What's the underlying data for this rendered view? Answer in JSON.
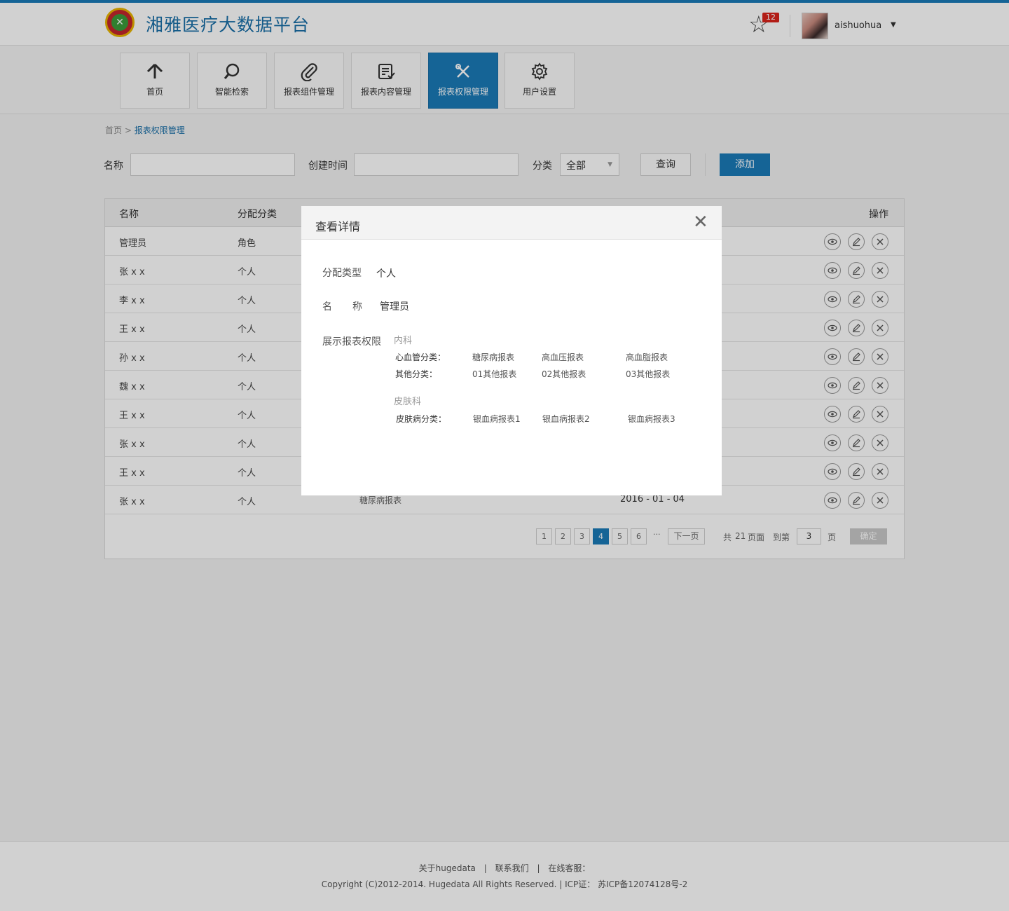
{
  "header": {
    "app_title": "湘雅医疗大数据平台",
    "logo_glyph": "✕",
    "notifications_count": "12",
    "username": "aishuohua",
    "user_caret": "▼",
    "accent_color": "#1a7ab8"
  },
  "nav": [
    {
      "label": "首页",
      "icon": "home-icon",
      "glyph": "⌂"
    },
    {
      "label": "智能检索",
      "icon": "search-icon",
      "glyph": "⚲"
    },
    {
      "label": "报表组件管理",
      "icon": "paperclip-icon",
      "glyph": "📎"
    },
    {
      "label": "报表内容管理",
      "icon": "report-icon",
      "glyph": "▤"
    },
    {
      "label": "报表权限管理",
      "icon": "tools-icon",
      "glyph": "✂",
      "active": true
    },
    {
      "label": "用户设置",
      "icon": "gear-icon",
      "glyph": "⚙"
    }
  ],
  "breadcrumb": {
    "home": "首页",
    "sep": ">",
    "current": "报表权限管理"
  },
  "filters": {
    "name_label": "名称",
    "created_label": "创建时间",
    "category_label": "分类",
    "category_value": "全部",
    "query_button": "查询",
    "add_button": "添加"
  },
  "table": {
    "headers": {
      "name": "名称",
      "category": "分配分类",
      "actions": "操作"
    },
    "rows": [
      {
        "name": "管理员",
        "category": "角色"
      },
      {
        "name": "张 x x",
        "category": "个人"
      },
      {
        "name": "李 x x",
        "category": "个人"
      },
      {
        "name": "王 x x",
        "category": "个人"
      },
      {
        "name": "孙 x x",
        "category": "个人"
      },
      {
        "name": "魏 x x",
        "category": "个人"
      },
      {
        "name": "王 x x",
        "category": "个人"
      },
      {
        "name": "张 x x",
        "category": "个人"
      },
      {
        "name": "王 x x",
        "category": "个人"
      },
      {
        "name": "张 x x",
        "category": "个人",
        "reports": "糖尿病报表",
        "date": "2016 - 01 - 04"
      }
    ]
  },
  "pager": {
    "pages": [
      "1",
      "2",
      "3",
      "4",
      "5",
      "6"
    ],
    "current": "4",
    "ellipsis": "···",
    "next": "下一页",
    "total_prefix": "共",
    "total": "21",
    "total_suffix": "页面",
    "goto_prefix": "到第",
    "goto_value": "3",
    "goto_suffix": "页",
    "confirm": "确定"
  },
  "modal": {
    "title": "查看详情",
    "close_glyph": "✕",
    "type_label": "分配类型",
    "type_value": "个人",
    "name_label_1": "名",
    "name_label_2": "称",
    "name_value": "管理员",
    "perm_label": "展示报表权限",
    "departments": [
      {
        "name": "内科",
        "groups": [
          {
            "label": "心血管分类：",
            "reports": [
              "糖尿病报表",
              "高血压报表",
              "高血脂报表"
            ]
          },
          {
            "label": "其他分类：",
            "reports": [
              "01其他报表",
              "02其他报表",
              "03其他报表"
            ]
          }
        ]
      },
      {
        "name": "皮肤科",
        "groups": [
          {
            "label": "皮肤病分类：",
            "reports": [
              "银血病报表1",
              "银血病报表2",
              "银血病报表3"
            ]
          }
        ]
      }
    ]
  },
  "footer": {
    "about": "关于hugedata",
    "contact": "联系我们",
    "service": "在线客服：",
    "separator": "|",
    "copyright": "Copyright (C)2012-2014. Hugedata All Rights Reserved. | ICP证： 苏ICP备12074128号-2"
  }
}
